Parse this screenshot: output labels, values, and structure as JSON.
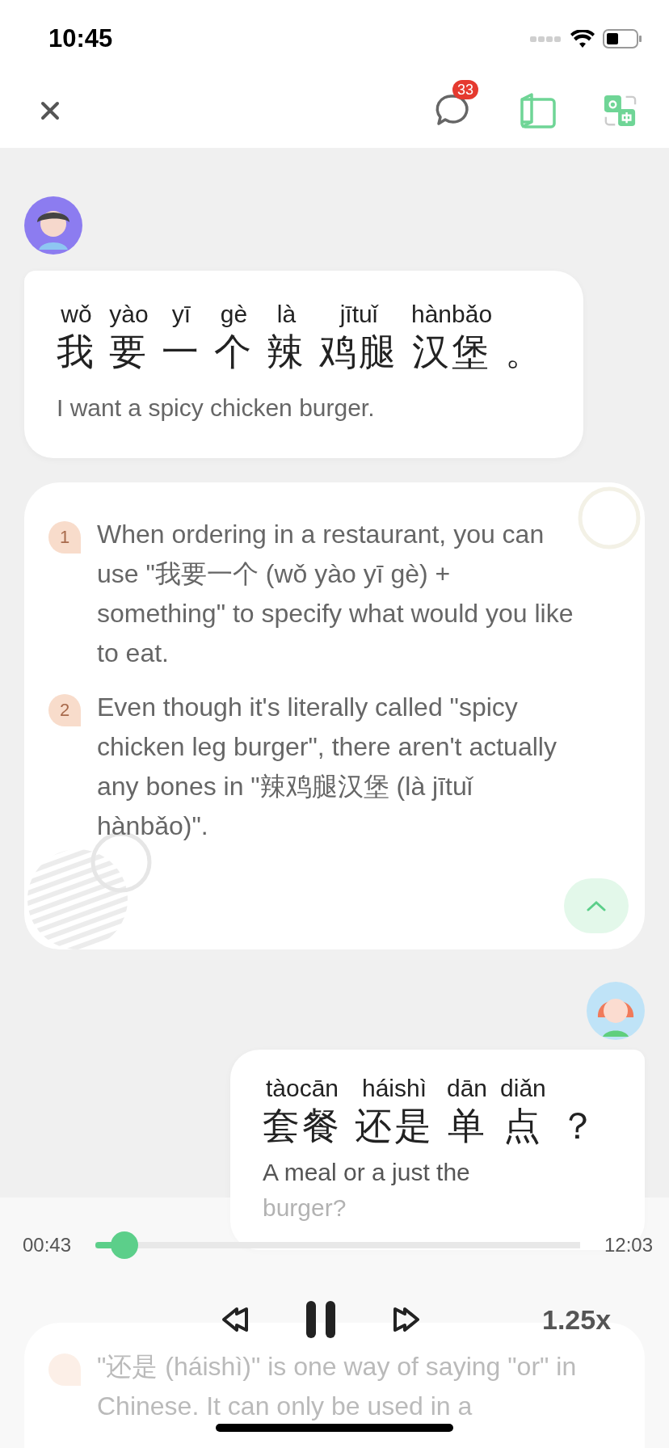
{
  "status_bar": {
    "time": "10:45"
  },
  "toolbar": {
    "badge": "33"
  },
  "messages": [
    {
      "kind": "left",
      "words": [
        {
          "pinyin": "wǒ",
          "hanzi": "我"
        },
        {
          "pinyin": "yào",
          "hanzi": "要"
        },
        {
          "pinyin": "yī",
          "hanzi": "一"
        },
        {
          "pinyin": "gè",
          "hanzi": "个"
        },
        {
          "pinyin": "là",
          "hanzi": "辣"
        },
        {
          "pinyin": "jītuǐ",
          "hanzi": "鸡腿"
        },
        {
          "pinyin": "hànbǎo",
          "hanzi": "汉堡"
        },
        {
          "hanzi": "。"
        }
      ],
      "translation": "I want a spicy chicken burger.",
      "notes": {
        "expanded": true,
        "items": [
          {
            "number": "1",
            "text": "When ordering in a restaurant, you can use \"我要一个 (wǒ yào yī gè) + something\" to specify what would you like to eat."
          },
          {
            "number": "2",
            "text": "Even though it's literally called \"spicy chicken leg burger\", there aren't actually any bones in \"辣鸡腿汉堡 (là jītuǐ hànbǎo)\"."
          }
        ]
      }
    },
    {
      "kind": "right",
      "words": [
        {
          "pinyin": "tàocān",
          "hanzi": "套餐"
        },
        {
          "pinyin": "háishì",
          "hanzi": "还是"
        },
        {
          "pinyin": "dān",
          "hanzi": "单"
        },
        {
          "pinyin": "diǎn",
          "hanzi": "点"
        },
        {
          "hanzi": "？"
        }
      ],
      "translation": "A meal or a just the burger?",
      "notes": {
        "items": [
          {
            "text": "\"还是 (háishì)\" is one way of saying \"or\" in Chinese. It can only be used in a"
          }
        ]
      }
    }
  ],
  "player": {
    "current": "00:43",
    "total": "12:03",
    "level": 0.06,
    "playing": true,
    "speed": "1.25x"
  }
}
